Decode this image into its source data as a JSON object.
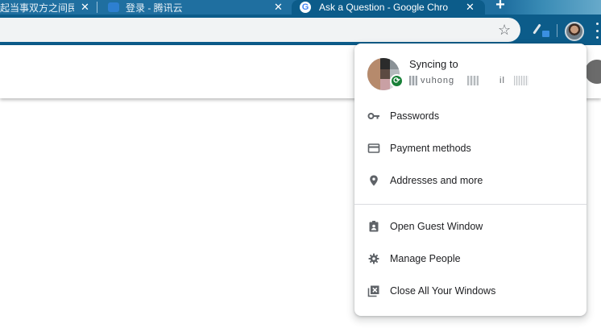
{
  "browser": {
    "tabs": [
      {
        "title": "起当事双方之间民",
        "active": false,
        "close": "✕"
      },
      {
        "title": "登录 - 腾讯云",
        "active": false,
        "close": "✕"
      },
      {
        "title": "Ask a Question - Google Chro",
        "active": true,
        "close": "✕",
        "favicon_letter": "G"
      }
    ],
    "new_tab_label": "+",
    "bookmark_icon": "☆"
  },
  "profile_menu": {
    "sync_title": "Syncing to",
    "sync_email": "vuhong",
    "sync_email_tail": "il",
    "sync_icon": "⟳",
    "items": [
      {
        "label": "Passwords",
        "icon": "key-icon"
      },
      {
        "label": "Payment methods",
        "icon": "credit-card-icon"
      },
      {
        "label": "Addresses and more",
        "icon": "location-pin-icon"
      },
      {
        "label": "Open Guest Window",
        "icon": "guest-badge-icon"
      },
      {
        "label": "Manage People",
        "icon": "gear-icon"
      },
      {
        "label": "Close All Your Windows",
        "icon": "close-windows-icon"
      }
    ]
  },
  "colors": {
    "tab_strip": "#1f6fa0",
    "toolbar": "#0c5c8a",
    "sync_green": "#188038"
  }
}
